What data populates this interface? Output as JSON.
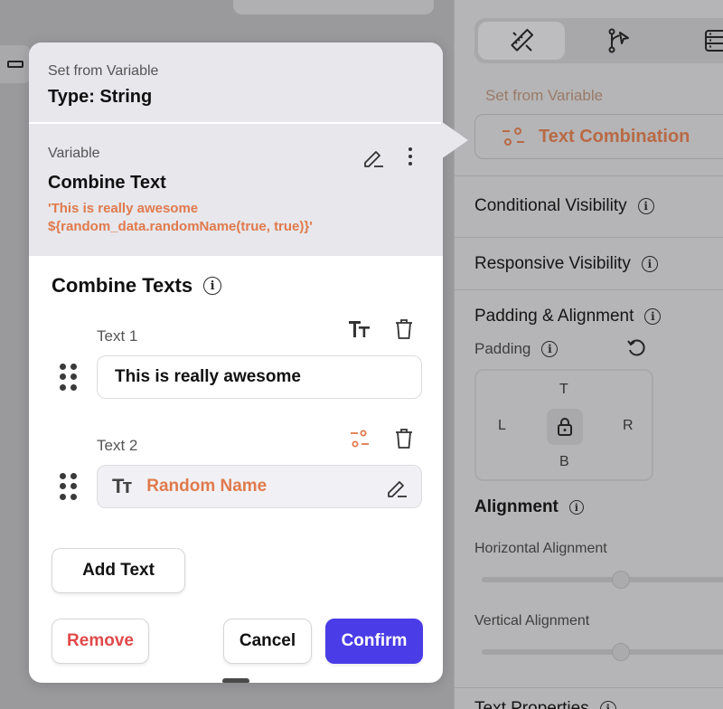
{
  "right_panel": {
    "set_from_variable_label": "Set from Variable",
    "source_value": "Text Combination",
    "sections": {
      "conditional_visibility": "Conditional Visibility",
      "responsive_visibility": "Responsive Visibility",
      "padding_alignment": "Padding & Alignment",
      "padding": "Padding",
      "alignment": "Alignment",
      "horizontal_alignment": "Horizontal Alignment",
      "vertical_alignment": "Vertical Alignment",
      "text_properties": "Text Properties"
    },
    "padding_sides": {
      "top": "T",
      "left": "L",
      "right": "R",
      "bottom": "B"
    },
    "info_glyph": "i"
  },
  "dialog": {
    "header": {
      "title": "Set from Variable",
      "type_label": "Type: String"
    },
    "variable": {
      "label": "Variable",
      "name": "Combine Text",
      "value": "'This is really awesome ${random_data.randomName(true, true)}'"
    },
    "combine": {
      "title": "Combine Texts",
      "text1": {
        "label": "Text 1",
        "value": "This is really awesome"
      },
      "text2": {
        "label": "Text 2",
        "chip_icon": "Tт",
        "value": "Random Name"
      }
    },
    "buttons": {
      "add_text": "Add Text",
      "remove": "Remove",
      "cancel": "Cancel",
      "confirm": "Confirm"
    }
  },
  "colors": {
    "accent_orange": "#e07a4c",
    "primary": "#4a3ce6",
    "danger": "#e0494a",
    "overlay_gray": "#9a9a9c"
  }
}
